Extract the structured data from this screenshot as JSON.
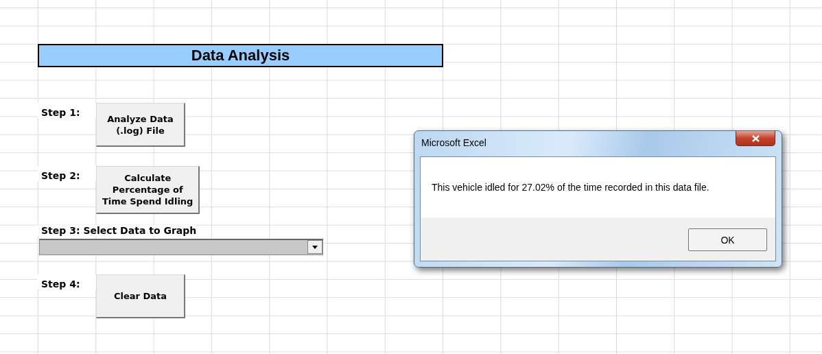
{
  "sheet": {
    "title": "Data Analysis",
    "steps": [
      {
        "kind": "button",
        "label": "Step 1:",
        "button": "Analyze Data\n(.log) File"
      },
      {
        "kind": "button",
        "label": "Step 2:",
        "button": "Calculate\nPercentage of\nTime Spend Idling"
      },
      {
        "kind": "dropdown",
        "label": "Step 3: Select Data to Graph"
      },
      {
        "kind": "button",
        "label": "Step 4:",
        "button": "Clear Data"
      }
    ]
  },
  "dialog": {
    "title": "Microsoft Excel",
    "message": "This vehicle idled for 27.02% of the time recorded in this data file.",
    "buttons": [
      "OK"
    ]
  }
}
